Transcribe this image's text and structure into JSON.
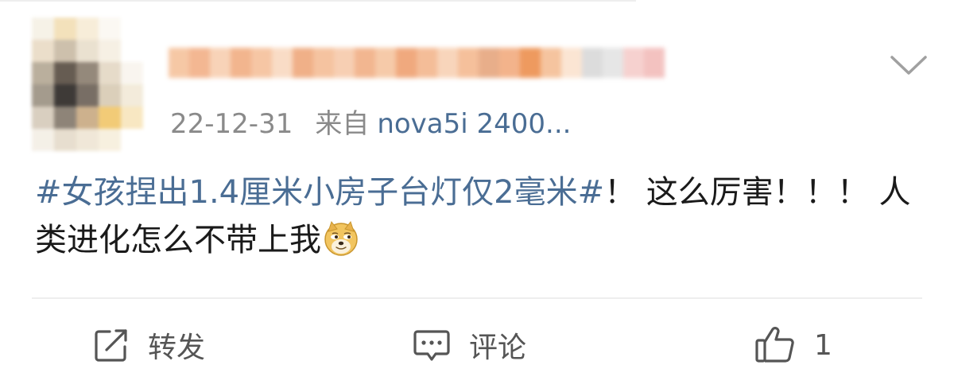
{
  "post": {
    "date": "22-12-31",
    "from_label": "来自",
    "source": "nova5i 2400...",
    "topic": "#女孩捏出1.4厘米小房子台灯仅2毫米#",
    "text": "！ 这么厉害！！！ 人类进化怎么不带上我"
  },
  "actions": {
    "repost_label": "转发",
    "comment_label": "评论",
    "like_count": "1"
  },
  "icons": {
    "more": "chevron-down-icon",
    "repost": "share-square-icon",
    "comment": "speech-bubble-icon",
    "like": "thumbs-up-icon",
    "emoji": "doge-emoji-icon"
  },
  "colors": {
    "link": "#4a6d94",
    "meta": "#8a8a8a",
    "icon": "#555555",
    "divider": "#eeeeee"
  }
}
